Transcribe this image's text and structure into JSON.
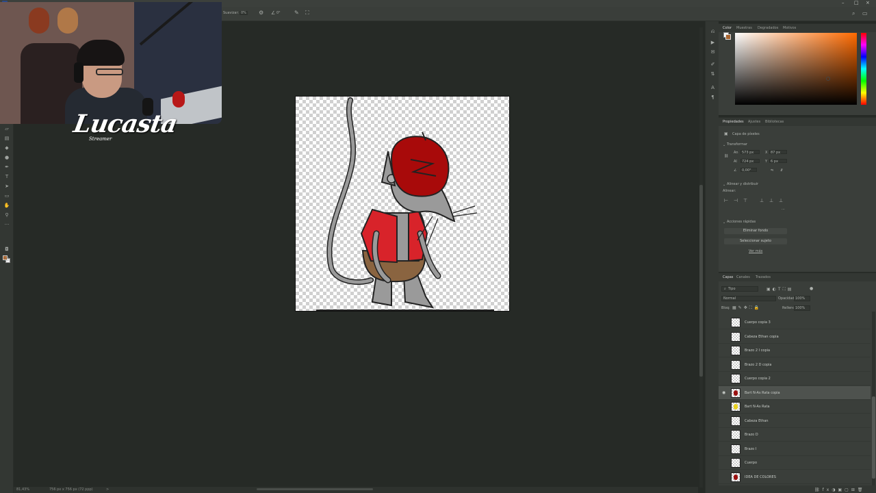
{
  "app": {
    "options_bar": [
      "Suavizar:",
      "0%",
      "0°"
    ],
    "window_controls": [
      "–",
      "□",
      "×"
    ]
  },
  "overlay": {
    "logo_text": "Lucasta",
    "logo_sub": "Streamer"
  },
  "status": {
    "zoom": "81,43%",
    "doc_size": "756 px x 756 px (72 ppp)",
    "arrow": ">"
  },
  "color_panel": {
    "tabs": [
      "Color",
      "Muestras",
      "Degradados",
      "Motivos"
    ],
    "fg_color": "#a8642e",
    "bg_color": "#ffffff",
    "hue_color": "#ff6a00"
  },
  "properties_panel": {
    "tabs": [
      "Propiedades",
      "Ajustes",
      "Bibliotecas"
    ],
    "layer_type": "Capa de píxeles",
    "transform_title": "Transformar",
    "w_label": "An",
    "w_value": "573 px",
    "x_label": "X",
    "x_value": "87 px",
    "h_label": "Al",
    "h_value": "724 px",
    "y_label": "Y",
    "y_value": "6 px",
    "angle_value": "0,00°",
    "align_title": "Alinear y distribuir",
    "align_sub": "Alinear:",
    "quick_title": "Acciones rápidas",
    "btn_remove_bg": "Eliminar fondo",
    "btn_select_subject": "Seleccionar sujeto",
    "more": "Ver más"
  },
  "layers_panel": {
    "tabs": [
      "Capas",
      "Canales",
      "Trazados"
    ],
    "filter": "Tipo",
    "blend_mode": "Normal",
    "opacity_label": "Opacidad:",
    "opacity_value": "100%",
    "lock_label": "Bloq:",
    "fill_label": "Relleno:",
    "fill_value": "100%",
    "layers": [
      {
        "name": "Cuerpo copia 3",
        "visible": false,
        "selected": false,
        "thumb": "transparent"
      },
      {
        "name": "Cabeza Ethan copia",
        "visible": false,
        "selected": false,
        "thumb": "transparent"
      },
      {
        "name": "Brazo 2 I copia",
        "visible": false,
        "selected": false,
        "thumb": "transparent"
      },
      {
        "name": "Brazo 2 D copia",
        "visible": false,
        "selected": false,
        "thumb": "transparent"
      },
      {
        "name": "Cuerpo copia 2",
        "visible": false,
        "selected": false,
        "thumb": "transparent"
      },
      {
        "name": "Bart N-As Rata copia",
        "visible": true,
        "selected": true,
        "thumb": "#9a1010"
      },
      {
        "name": "Bart N-As Rata",
        "visible": false,
        "selected": false,
        "thumb": "#e8d020"
      },
      {
        "name": "Cabeza Ethan",
        "visible": false,
        "selected": false,
        "thumb": "transparent"
      },
      {
        "name": "Brazo D",
        "visible": false,
        "selected": false,
        "thumb": "transparent"
      },
      {
        "name": "Brazo I",
        "visible": false,
        "selected": false,
        "thumb": "transparent"
      },
      {
        "name": "Cuerpo",
        "visible": false,
        "selected": false,
        "thumb": "transparent"
      },
      {
        "name": "IDEA DE COLORES",
        "visible": false,
        "selected": false,
        "thumb": "#9a1010"
      }
    ]
  },
  "artwork": {
    "hat_color": "#a80a0a",
    "shirt_color": "#d8232a",
    "fur_color": "#9a9a9a",
    "shorts_color": "#8a6440"
  }
}
